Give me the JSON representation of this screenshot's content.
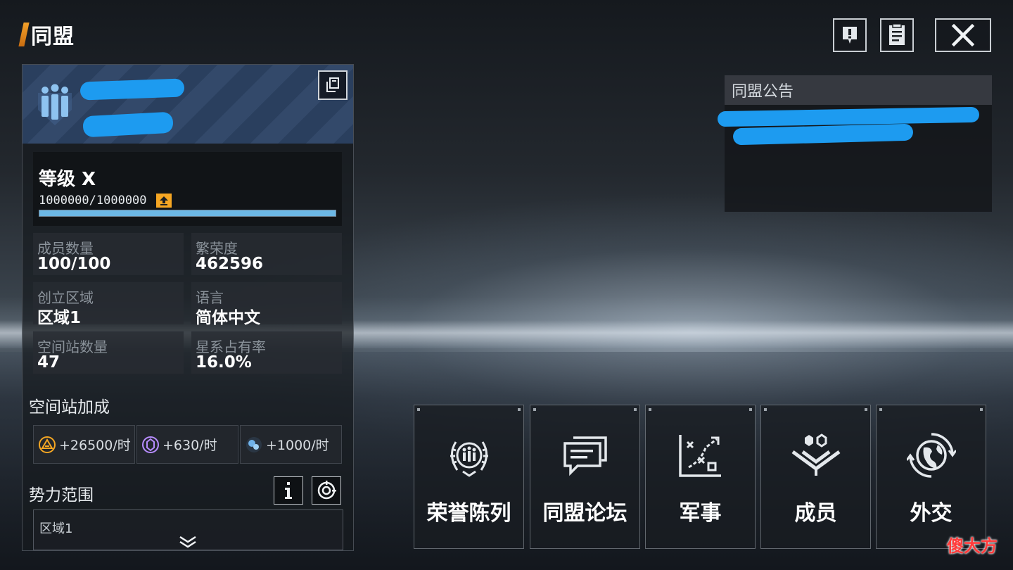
{
  "page": {
    "title": "同盟"
  },
  "topbar": {
    "report_icon": "exclamation-icon",
    "log_icon": "log-list-icon",
    "close_icon": "close-icon"
  },
  "alliance": {
    "level_label": "等级 X",
    "exp_text": "1000000/1000000",
    "exp_progress": 1.0,
    "stats": [
      {
        "label": "成员数量",
        "value": "100/100"
      },
      {
        "label": "繁荣度",
        "value": "462596"
      },
      {
        "label": "创立区域",
        "value": "区域1"
      },
      {
        "label": "语言",
        "value": "简体中文"
      },
      {
        "label": "空间站数量",
        "value": "47"
      },
      {
        "label": "星系占有率",
        "value": "16.0%"
      }
    ]
  },
  "station_bonus": {
    "title": "空间站加成",
    "items": [
      {
        "icon": "resource-a-icon",
        "value": "+26500/时",
        "color": "#f5a623"
      },
      {
        "icon": "resource-b-icon",
        "value": "+630/时",
        "color": "#b78cff"
      },
      {
        "icon": "resource-c-icon",
        "value": "+1000/时",
        "color": "#6fb2ea"
      }
    ]
  },
  "territory": {
    "title": "势力范围",
    "items": [
      "区域1"
    ]
  },
  "announcement": {
    "title": "同盟公告"
  },
  "nav": [
    {
      "label": "荣誉陈列",
      "icon": "honor-laurel-icon"
    },
    {
      "label": "同盟论坛",
      "icon": "forum-chat-icon"
    },
    {
      "label": "军事",
      "icon": "military-tactics-icon"
    },
    {
      "label": "成员",
      "icon": "members-icon"
    },
    {
      "label": "外交",
      "icon": "diplomacy-globe-icon"
    }
  ],
  "watermark": "傻大方",
  "colors": {
    "accent": "#f3a12a",
    "exp_bar": "#6cb8e6",
    "redaction": "#1d9bf0"
  }
}
